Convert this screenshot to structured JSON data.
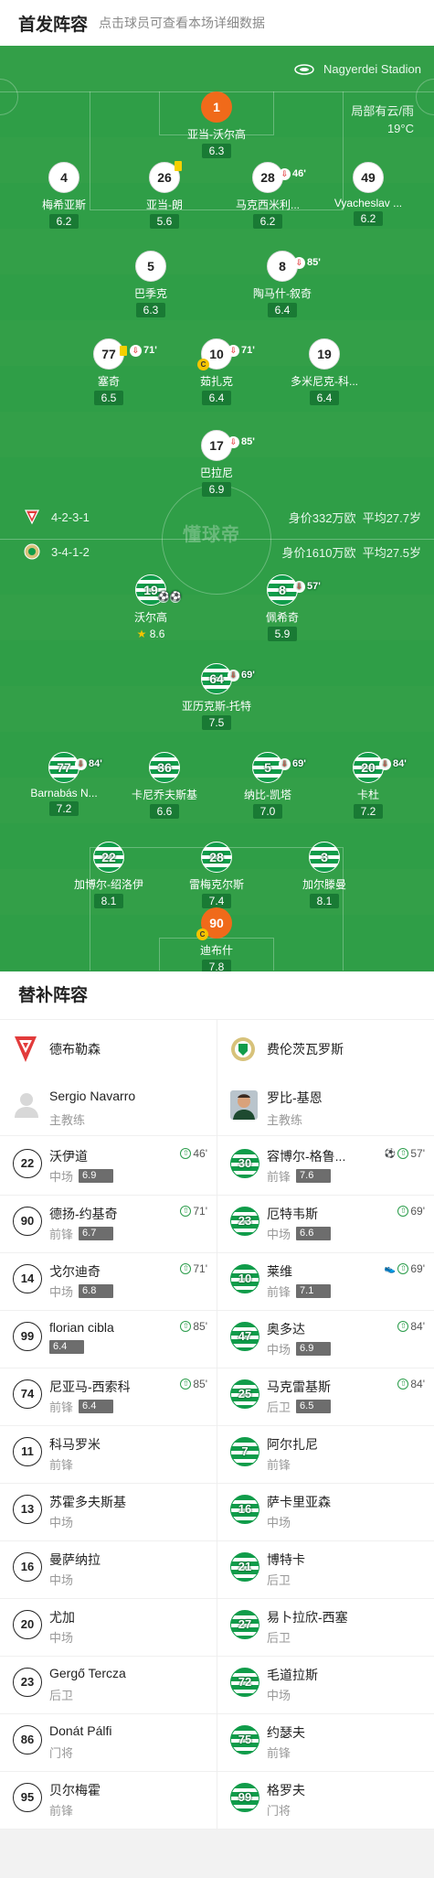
{
  "header": {
    "title": "首发阵容",
    "subtitle": "点击球员可查看本场详细数据"
  },
  "pitch": {
    "stadium": "Nagyerdei Stadion",
    "weather_line1": "局部有云/雨",
    "weather_line2": "19°C",
    "watermark": "懂球帝",
    "home_form": {
      "formation": "4-2-3-1",
      "value": "身价332万欧",
      "age": "平均27.7岁"
    },
    "away_form": {
      "formation": "3-4-1-2",
      "value": "身价1610万欧",
      "age": "平均27.5岁"
    }
  },
  "home_players": [
    {
      "num": "1",
      "name": "亚当-沃尔高",
      "rating": "6.3",
      "gk": true
    },
    {
      "num": "4",
      "name": "梅希亚斯",
      "rating": "6.2"
    },
    {
      "num": "26",
      "name": "亚当-朗",
      "rating": "5.6",
      "yellow": true
    },
    {
      "num": "28",
      "name": "马克西米利...",
      "rating": "6.2",
      "off": "46'"
    },
    {
      "num": "49",
      "name": "Vyacheslav ...",
      "rating": "6.2"
    },
    {
      "num": "5",
      "name": "巴季克",
      "rating": "6.3"
    },
    {
      "num": "8",
      "name": "陶马什-叙奇",
      "rating": "6.4",
      "off": "85'"
    },
    {
      "num": "77",
      "name": "塞奇",
      "rating": "6.5",
      "yellow": true,
      "off": "71'"
    },
    {
      "num": "10",
      "name": "茹扎克",
      "rating": "6.4",
      "off": "71'",
      "captain": true
    },
    {
      "num": "19",
      "name": "多米尼克-科...",
      "rating": "6.4"
    },
    {
      "num": "17",
      "name": "巴拉尼",
      "rating": "6.9",
      "off": "85'"
    }
  ],
  "away_players": [
    {
      "num": "19",
      "name": "沃尔高",
      "rating": "8.6",
      "star": true,
      "goals": 2
    },
    {
      "num": "8",
      "name": "佩希奇",
      "rating": "5.9",
      "off": "57'"
    },
    {
      "num": "64",
      "name": "亚历克斯-托特",
      "rating": "7.5",
      "off": "69'"
    },
    {
      "num": "77",
      "name": "Barnabás N...",
      "rating": "7.2",
      "off": "84'"
    },
    {
      "num": "36",
      "name": "卡尼乔夫斯基",
      "rating": "6.6"
    },
    {
      "num": "5",
      "name": "纳比-凯塔",
      "rating": "7.0",
      "off": "69'"
    },
    {
      "num": "20",
      "name": "卡杜",
      "rating": "7.2",
      "off": "84'"
    },
    {
      "num": "22",
      "name": "加博尔-绍洛伊",
      "rating": "8.1"
    },
    {
      "num": "28",
      "name": "雷梅克尔斯",
      "rating": "7.4"
    },
    {
      "num": "3",
      "name": "加尔滕曼",
      "rating": "8.1"
    },
    {
      "num": "90",
      "name": "迪布什",
      "rating": "7.8",
      "gk": true,
      "captain": true
    }
  ],
  "subs": {
    "title": "替补阵容",
    "home_team": "德布勒森",
    "away_team": "费伦茨瓦罗斯",
    "home_coach": {
      "name": "Sergio Navarro",
      "role": "主教练"
    },
    "away_coach": {
      "name": "罗比-基恩",
      "role": "主教练"
    },
    "home": [
      {
        "num": "22",
        "name": "沃伊道",
        "pos": "中场",
        "rating": "6.9",
        "in": "46'"
      },
      {
        "num": "90",
        "name": "德扬-约基奇",
        "pos": "前锋",
        "rating": "6.7",
        "in": "71'"
      },
      {
        "num": "14",
        "name": "戈尔迪奇",
        "pos": "中场",
        "rating": "6.8",
        "in": "71'"
      },
      {
        "num": "99",
        "name": "florian cibla",
        "pos": "",
        "rating": "6.4",
        "in": "85'"
      },
      {
        "num": "74",
        "name": "尼亚马-西索科",
        "pos": "前锋",
        "rating": "6.4",
        "in": "85'"
      },
      {
        "num": "11",
        "name": "科马罗米",
        "pos": "前锋"
      },
      {
        "num": "13",
        "name": "苏霍多夫斯基",
        "pos": "中场"
      },
      {
        "num": "16",
        "name": "曼萨纳拉",
        "pos": "中场"
      },
      {
        "num": "20",
        "name": "尤加",
        "pos": "中场"
      },
      {
        "num": "23",
        "name": "Gergő Tercza",
        "pos": "后卫"
      },
      {
        "num": "86",
        "name": "Donát Pálfi",
        "pos": "门将"
      },
      {
        "num": "95",
        "name": "贝尔梅霍",
        "pos": "前锋"
      }
    ],
    "away": [
      {
        "num": "30",
        "name": "容博尔-格鲁...",
        "pos": "前锋",
        "rating": "7.6",
        "in": "57'",
        "goal": true
      },
      {
        "num": "23",
        "name": "厄特韦斯",
        "pos": "中场",
        "rating": "6.6",
        "in": "69'"
      },
      {
        "num": "10",
        "name": "莱维",
        "pos": "前锋",
        "rating": "7.1",
        "in": "69'",
        "assist": true
      },
      {
        "num": "47",
        "name": "奥多达",
        "pos": "中场",
        "rating": "6.9",
        "in": "84'"
      },
      {
        "num": "25",
        "name": "马克雷基斯",
        "pos": "后卫",
        "rating": "6.5",
        "in": "84'"
      },
      {
        "num": "7",
        "name": "阿尔扎尼",
        "pos": "前锋"
      },
      {
        "num": "16",
        "name": "萨卡里亚森",
        "pos": "中场"
      },
      {
        "num": "21",
        "name": "博特卡",
        "pos": "后卫"
      },
      {
        "num": "27",
        "name": "易卜拉欣-西塞",
        "pos": "后卫"
      },
      {
        "num": "72",
        "name": "毛道拉斯",
        "pos": "中场"
      },
      {
        "num": "75",
        "name": "约瑟夫",
        "pos": "前锋"
      },
      {
        "num": "99",
        "name": "格罗夫",
        "pos": "门将"
      }
    ]
  },
  "colors": {
    "pitch": "#2f9e47",
    "rating_bg": "#197a34",
    "gk_orange": "#f06a1a",
    "celtic_green": "#109c4a",
    "sub_off": "#e23b3b",
    "sub_in": "#2a9c4a"
  }
}
